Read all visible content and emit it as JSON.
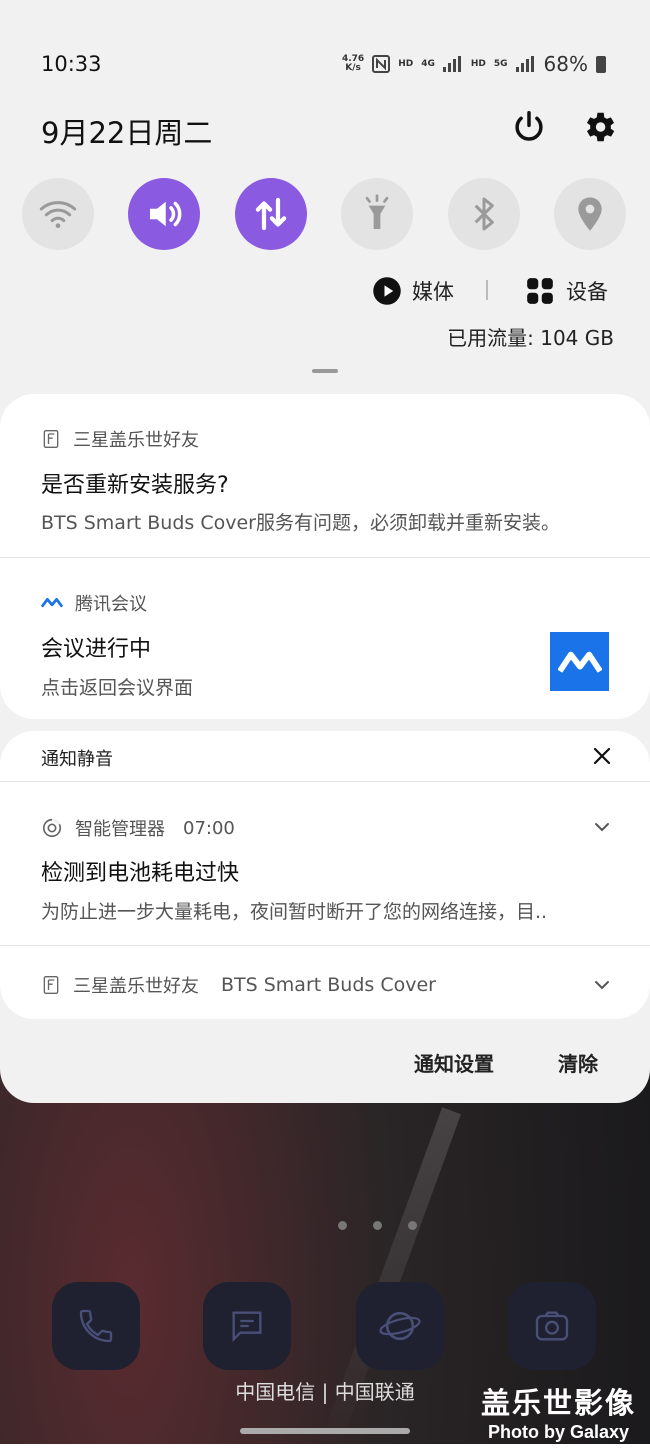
{
  "status_bar": {
    "time": "10:33",
    "net_speed_value": "4.76",
    "net_speed_unit": "K/s",
    "hd1": "HD",
    "lte": "4G",
    "hd2": "HD",
    "fiveg": "5G",
    "battery": "68%"
  },
  "header": {
    "date": "9月22日周二"
  },
  "quick_settings": {
    "tiles": [
      {
        "icon": "wifi-icon",
        "active": false
      },
      {
        "icon": "sound-icon",
        "active": true
      },
      {
        "icon": "mobile-data-icon",
        "active": true
      },
      {
        "icon": "flashlight-icon",
        "active": false
      },
      {
        "icon": "bluetooth-icon",
        "active": false
      },
      {
        "icon": "location-icon",
        "active": false
      }
    ],
    "accent_color": "#8a5be0",
    "media_label": "媒体",
    "devices_label": "设备",
    "data_usage": "已用流量: 104 GB"
  },
  "notifications": {
    "n1": {
      "app": "三星盖乐世好友",
      "title": "是否重新安装服务?",
      "body": "BTS Smart Buds Cover服务有问题，必须卸载并重新安装。"
    },
    "n2": {
      "app": "腾讯会议",
      "title": "会议进行中",
      "body": "点击返回会议界面",
      "thumb_color": "#1a73e8"
    },
    "silent_header": "通知静音",
    "n3": {
      "app": "智能管理器",
      "time": "07:00",
      "title": "检测到电池耗电过快",
      "body": "为防止进一步大量耗电，夜间暂时断开了您的网络连接，目.."
    },
    "n4": {
      "app": "三星盖乐世好友",
      "subtitle": "BTS Smart Buds Cover"
    }
  },
  "panel_actions": {
    "settings": "通知设置",
    "clear": "清除"
  },
  "home": {
    "carrier": "中国电信 | 中国联通",
    "dock": [
      "phone-icon",
      "messages-icon",
      "internet-icon",
      "camera-icon"
    ],
    "watermark_title": "盖乐世影像",
    "watermark_sub": "Photo by Galaxy"
  }
}
